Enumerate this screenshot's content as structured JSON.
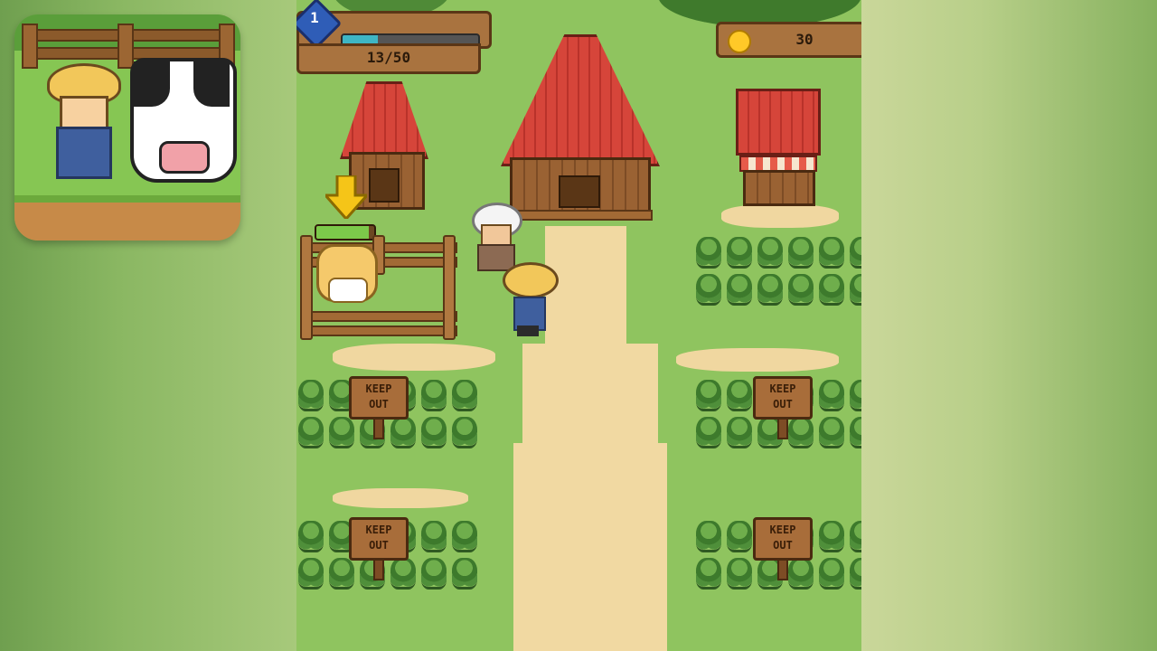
{
  "hud": {
    "level": "1",
    "xp_text": "13/50",
    "xp_progress": 0.26,
    "coins": "30"
  },
  "pen": {
    "fill_progress": 0.9
  },
  "signs": {
    "sign_1": "KEEP\nOUT",
    "sign_2": "KEEP\nOUT",
    "sign_3": "KEEP\nOUT",
    "sign_4": "KEEP\nOUT"
  },
  "icons": {
    "level_badge": "level-badge-icon",
    "coin": "gold-coin-icon",
    "arrow": "down-arrow-icon"
  },
  "colors": {
    "xp_fill": "#3fb6c4",
    "coin": "#ffc928",
    "roof": "#d6453a",
    "grass": "#8fc45f",
    "path": "#f1d9a2"
  }
}
